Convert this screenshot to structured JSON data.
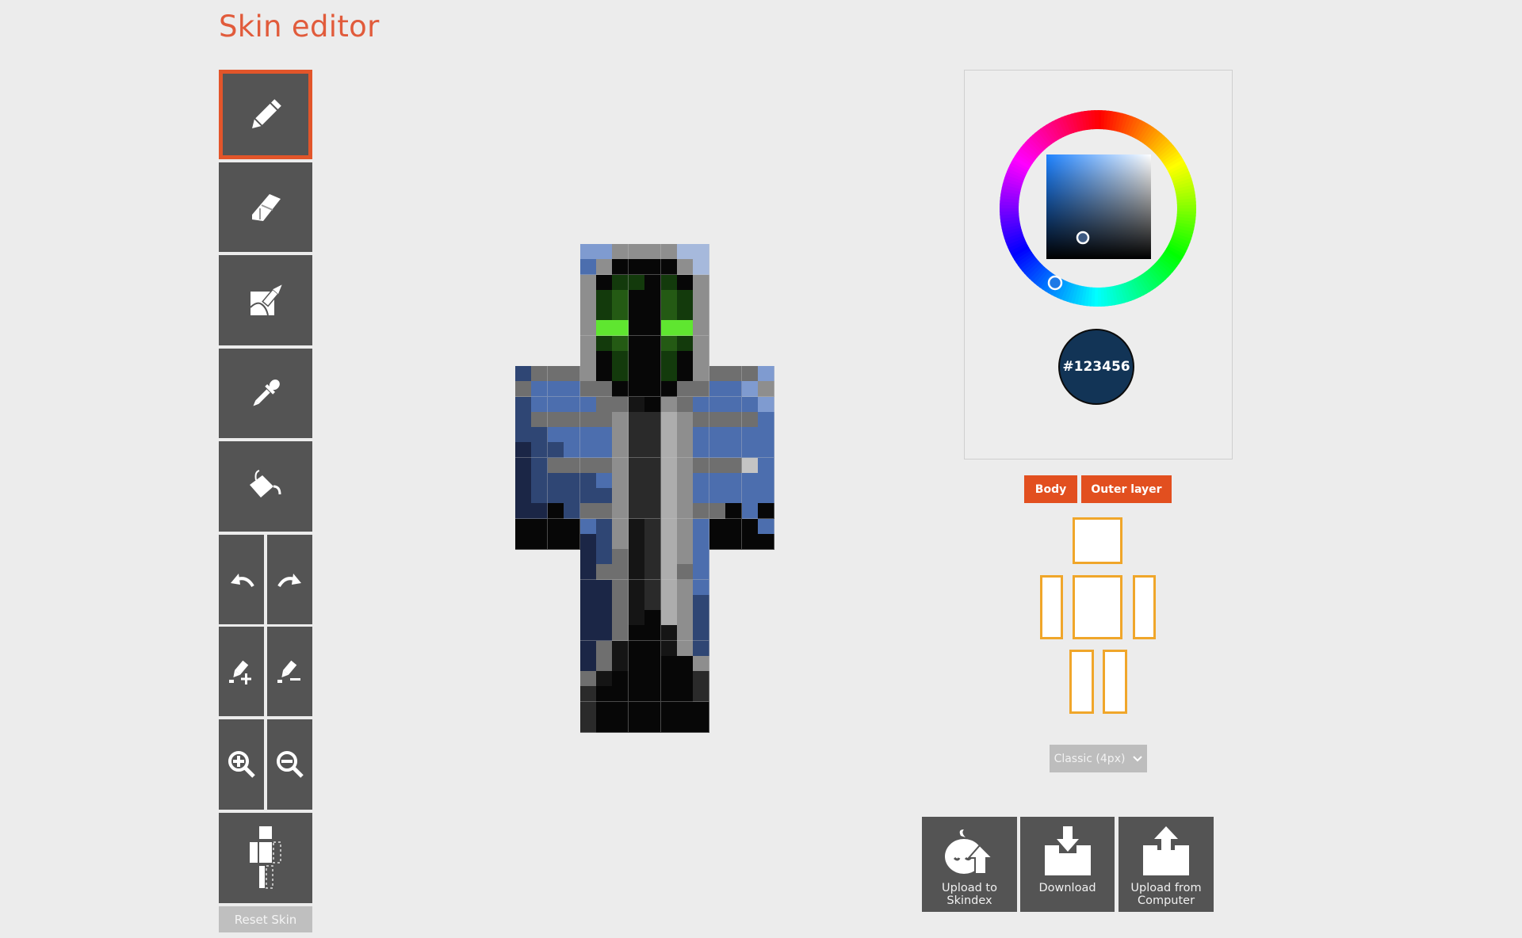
{
  "page": {
    "title": "Skin editor"
  },
  "toolbar": {
    "tools": [
      {
        "id": "pencil",
        "label": "Pencil",
        "icon": "pencil-icon",
        "active": true
      },
      {
        "id": "eraser",
        "label": "Eraser",
        "icon": "eraser-icon",
        "active": false
      },
      {
        "id": "fill-area",
        "label": "Brush fill",
        "icon": "brush-fill-icon",
        "active": false
      },
      {
        "id": "eyedropper",
        "label": "Color picker",
        "icon": "eyedropper-icon",
        "active": false
      },
      {
        "id": "bucket",
        "label": "Paint bucket",
        "icon": "paint-bucket-icon",
        "active": false
      }
    ],
    "undo": "Undo",
    "redo": "Redo",
    "lighten": "Lighten",
    "darken": "Darken",
    "zoom_in": "Zoom in",
    "zoom_out": "Zoom out",
    "toggle_parts": "Toggle body parts",
    "reset_label": "Reset Skin"
  },
  "color_picker": {
    "hex": "#123456",
    "hue_degrees": 210,
    "accent": "#e24f1f"
  },
  "layers": {
    "body_label": "Body",
    "outer_label": "Outer layer"
  },
  "body_parts": [
    "head",
    "left-arm",
    "torso",
    "right-arm",
    "left-leg",
    "right-leg"
  ],
  "model_select": {
    "selected": "Classic (4px)"
  },
  "actions": [
    {
      "id": "upload-skindex",
      "line1": "Upload to",
      "line2": "Skindex"
    },
    {
      "id": "download",
      "line1": "Download",
      "line2": ""
    },
    {
      "id": "upload-computer",
      "line1": "Upload from",
      "line2": "Computer"
    }
  ],
  "skin": {
    "palette": {
      "K": "#070707",
      "k": "#151515",
      "D": "#2a2a2a",
      "d": "#3c3c3c",
      "G": "#6f6f6f",
      "g": "#8e8e8e",
      "L": "#adadad",
      "l": "#c4c4c4",
      "B": "#4c6eae",
      "b": "#2f4674",
      "n": "#1b2646",
      "m": "#121a30",
      "P": "#7f9bd0",
      "p": "#a6b9dc",
      "E": "#5fe630",
      "e": "#245a14",
      "f": "#133a0c",
      "h": "#0c220a"
    },
    "rows": [
      "....PPggggpp....",
      "....BgKKKKgp....",
      "....gKffKfKg....",
      "....gfeKKefg....",
      "....gfeKKefg....",
      "....gEEKKEEg....",
      "....gfeKKefg....",
      "....gKfKKfKg....",
      "bGGGgKfKKfKgGGGP",
      "GBBBGGKKKKGGBBPg",
      "bBBBBGGkKgGBBBBP",
      "bGGGGGgDDLgGGGGB",
      "bbBBBBgDDLgBBBBB",
      "nbbBBBgDDLgBBBBB",
      "nbGGGGgDDLgGGGlB",
      "nbbbbBgDDLgBBBBB",
      "nbbbbbgDDLgBBBBB",
      "nnKbGGgDDLgGGKBK",
      "KKKKBbgkDLgBKKKB",
      "KKKKnbgkDLgBKKKK",
      "....nbGkDLgB....",
      "....nGGkDLGB....",
      "....nnGkDLgB....",
      "....nnGkDLgb....",
      "....nnGkKLgb....",
      "....nnGKKkgb....",
      "....nGkKKkgb....",
      "....nGkKKKKg....",
      "....GkKKKKKD....",
      "....DKKKKKKD....",
      "....DKKKKKKK....",
      "....DKKKKKKK...."
    ]
  }
}
